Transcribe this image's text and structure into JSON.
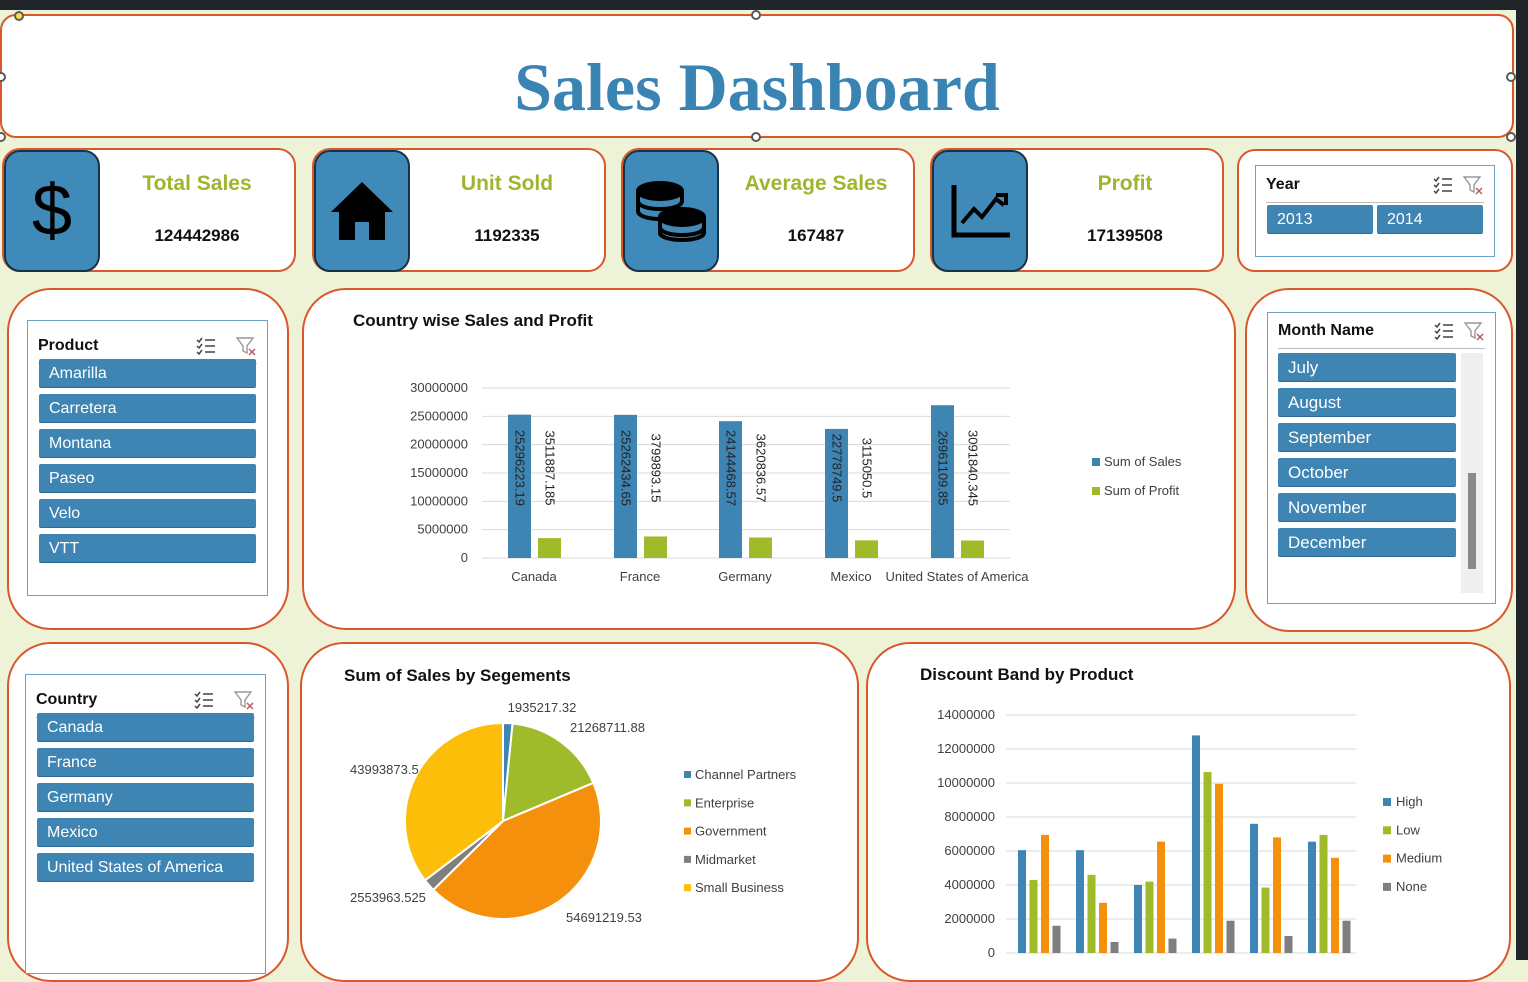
{
  "title": "Sales Dashboard",
  "kpis": [
    {
      "label": "Total Sales",
      "value": "124442986",
      "icon": "dollar-icon"
    },
    {
      "label": "Unit Sold",
      "value": "1192335",
      "icon": "house-icon"
    },
    {
      "label": "Average Sales",
      "value": "167487",
      "icon": "coins-icon"
    },
    {
      "label": "Profit",
      "value": "17139508",
      "icon": "trend-chart-icon"
    }
  ],
  "year_slicer": {
    "title": "Year",
    "items": [
      "2013",
      "2014"
    ]
  },
  "product_slicer": {
    "title": "Product",
    "items": [
      "Amarilla",
      "Carretera",
      "Montana",
      "Paseo",
      "Velo",
      "VTT"
    ]
  },
  "month_slicer": {
    "title": "Month Name",
    "items": [
      "July",
      "August",
      "September",
      "October",
      "November",
      "December"
    ]
  },
  "country_slicer": {
    "title": "Country",
    "items": [
      "Canada",
      "France",
      "Germany",
      "Mexico",
      "United States of America"
    ]
  },
  "colors": {
    "accent": "#3f85b4",
    "border": "#d8582c",
    "kpi_label": "#a0b52f",
    "title": "#3a84b3",
    "background": "#eef2d6"
  },
  "chart_data": [
    {
      "id": "country",
      "type": "bar",
      "title": "Country wise Sales and Profit",
      "categories": [
        "Canada",
        "France",
        "Germany",
        "Mexico",
        "United States of America"
      ],
      "series": [
        {
          "name": "Sum of  Sales",
          "color": "#3f85b4",
          "values": [
            25296223.19,
            25262434.65,
            24144468.57,
            22778749.5,
            26961109.85
          ],
          "labels": [
            "25296223.19",
            "25262434.65",
            "24144468.57",
            "22778749.5",
            "26961109.85"
          ]
        },
        {
          "name": "Sum of Profit",
          "color": "#9fbb2a",
          "values": [
            3511887.185,
            3799893.15,
            3620836.57,
            3115050.5,
            3091840.345
          ],
          "labels": [
            "3511887.185",
            "3799893.15",
            "3620836.57",
            "3115050.5",
            "3091840.345"
          ]
        }
      ],
      "yticks": [
        "0",
        "5000000",
        "10000000",
        "15000000",
        "20000000",
        "25000000",
        "30000000"
      ],
      "ylim": [
        0,
        30000000
      ],
      "legend": "right",
      "grid": true
    },
    {
      "id": "segments",
      "type": "pie",
      "title": "Sum of Sales by Segements",
      "slices": [
        {
          "name": "Channel Partners",
          "value": 1935217.32,
          "label": "1935217.32",
          "color": "#3f85b4"
        },
        {
          "name": "Enterprise",
          "value": 21268711.88,
          "label": "21268711.88",
          "color": "#9fbb2a"
        },
        {
          "name": "Government",
          "value": 54691219.53,
          "label": "54691219.53",
          "color": "#f4900c"
        },
        {
          "name": "Midmarket",
          "value": 2553963.525,
          "label": "2553963.525",
          "color": "#7f7f7f"
        },
        {
          "name": "Small Business",
          "value": 43993873.5,
          "label": "43993873.5",
          "color": "#fdbe0a"
        }
      ],
      "legend": "right"
    },
    {
      "id": "discount",
      "type": "bar",
      "title": "Discount Band by Product",
      "categories": [
        "",
        "",
        "",
        "",
        "",
        ""
      ],
      "series": [
        {
          "name": "High",
          "color": "#3f85b4",
          "values": [
            6050000,
            6050000,
            4000000,
            12800000,
            7600000,
            6550000
          ]
        },
        {
          "name": "Low",
          "color": "#9fbb2a",
          "values": [
            4300000,
            4600000,
            4200000,
            10650000,
            3850000,
            6950000
          ]
        },
        {
          "name": "Medium",
          "color": "#f4900c",
          "values": [
            6950000,
            2950000,
            6550000,
            9950000,
            6800000,
            5600000
          ]
        },
        {
          "name": "None",
          "color": "#7f7f7f",
          "values": [
            1600000,
            650000,
            850000,
            1900000,
            1000000,
            1900000
          ]
        }
      ],
      "yticks": [
        "0",
        "2000000",
        "4000000",
        "6000000",
        "8000000",
        "10000000",
        "12000000",
        "14000000"
      ],
      "ylim": [
        0,
        14000000
      ],
      "legend": "right",
      "grid": true
    }
  ]
}
